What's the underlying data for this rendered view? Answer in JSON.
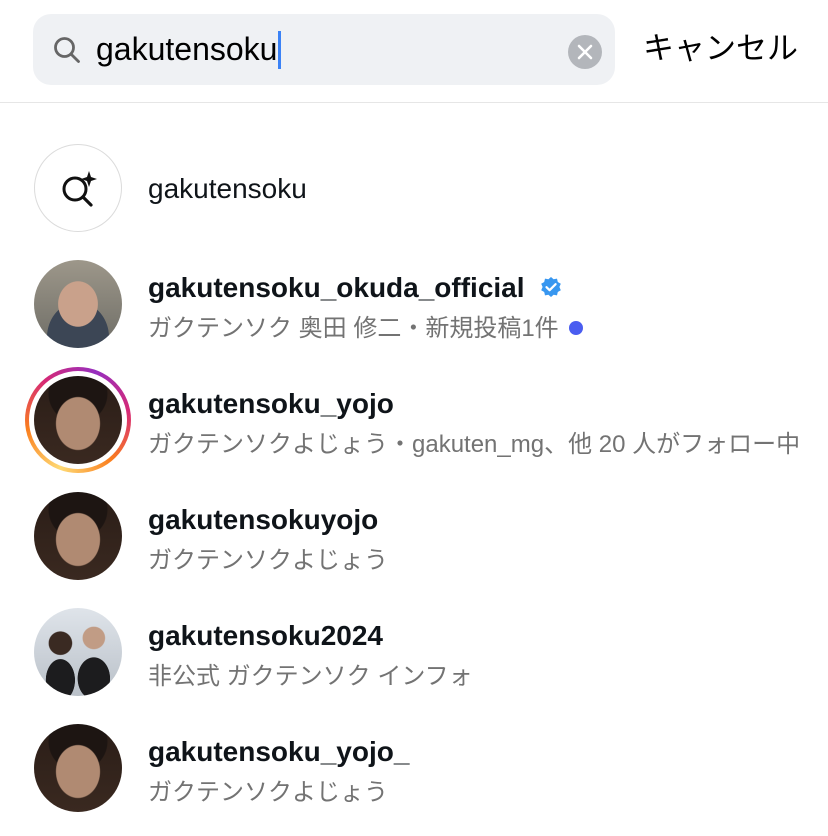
{
  "search": {
    "query": "gakutensoku",
    "cancel_label": "キャンセル"
  },
  "results": [
    {
      "kind": "keyword",
      "title": "gakutensoku",
      "icon": "ai-search-sparkle-icon"
    },
    {
      "kind": "user",
      "username": "gakutensoku_okuda_official",
      "verified": true,
      "subtitle": "ガクテンソク 奥田 修二・新規投稿1件",
      "new_post_dot": true
    },
    {
      "kind": "user",
      "username": "gakutensoku_yojo",
      "has_story": true,
      "subtitle": "ガクテンソクよじょう・gakuten_mg、他 20 人がフォロー中"
    },
    {
      "kind": "user",
      "username": "gakutensokuyojo",
      "subtitle": "ガクテンソクよじょう"
    },
    {
      "kind": "user",
      "username": "gakutensoku2024",
      "subtitle": "非公式 ガクテンソク インフォ"
    },
    {
      "kind": "user",
      "username": "gakutensoku_yojo_",
      "subtitle": "ガクテンソクよじょう"
    }
  ],
  "colors": {
    "search_bg": "#eff1f4",
    "verified_blue": "#3897f0",
    "new_post_dot": "#4a5df0",
    "secondary_text": "#737373"
  }
}
